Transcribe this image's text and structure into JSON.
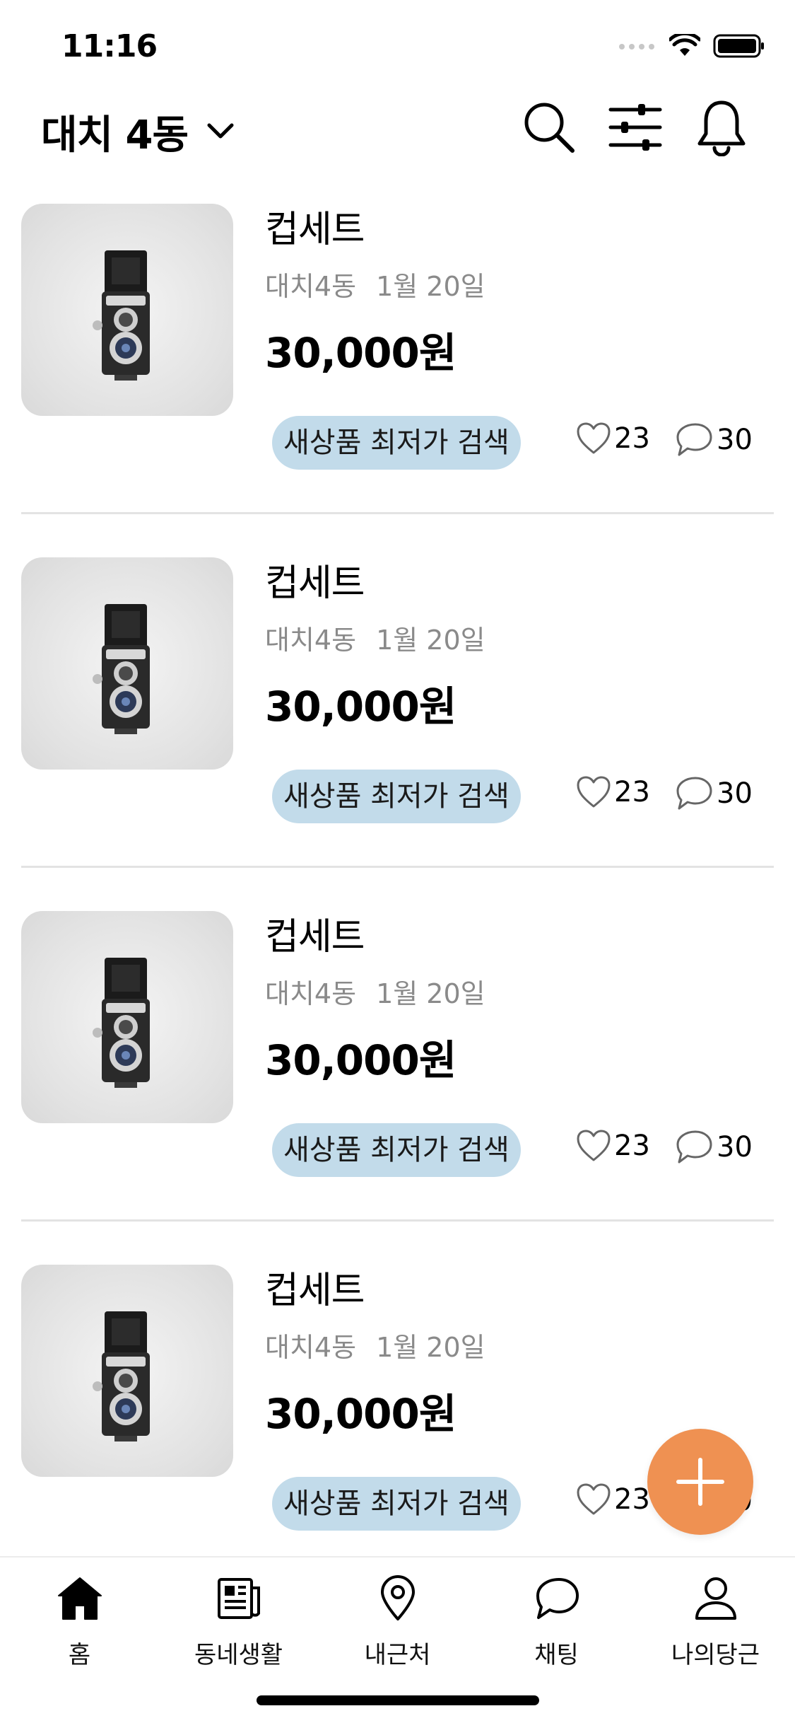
{
  "status_bar": {
    "time": "11:16"
  },
  "header": {
    "location": "대치 4동"
  },
  "items": [
    {
      "title": "컵세트",
      "location": "대치4동",
      "date": "1월 20일",
      "price": "30,000원",
      "tag": "새상품 최저가 검색",
      "likes": "23",
      "chats": "30"
    },
    {
      "title": "컵세트",
      "location": "대치4동",
      "date": "1월 20일",
      "price": "30,000원",
      "tag": "새상품 최저가 검색",
      "likes": "23",
      "chats": "30"
    },
    {
      "title": "컵세트",
      "location": "대치4동",
      "date": "1월 20일",
      "price": "30,000원",
      "tag": "새상품 최저가 검색",
      "likes": "23",
      "chats": "30"
    },
    {
      "title": "컵세트",
      "location": "대치4동",
      "date": "1월 20일",
      "price": "30,000원",
      "tag": "새상품 최저가 검색",
      "likes": "23",
      "chats": "30"
    }
  ],
  "fab": {
    "icon": "plus-icon",
    "color": "#ef9152"
  },
  "tab_bar": {
    "tabs": [
      {
        "label": "홈",
        "icon": "home-icon",
        "active": true
      },
      {
        "label": "동네생활",
        "icon": "newspaper-icon",
        "active": false
      },
      {
        "label": "내근처",
        "icon": "location-pin-icon",
        "active": false
      },
      {
        "label": "채팅",
        "icon": "chat-bubble-icon",
        "active": false
      },
      {
        "label": "나의당근",
        "icon": "person-icon",
        "active": false
      }
    ]
  },
  "colors": {
    "accent": "#ef9152",
    "tag_background": "#c2dbea",
    "meta_text": "#8a8a8a"
  }
}
